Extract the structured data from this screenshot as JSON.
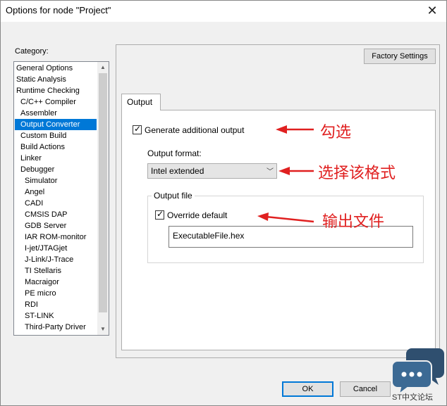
{
  "window": {
    "title": "Options for node \"Project\"",
    "close_glyph": "✕"
  },
  "category": {
    "label": "Category:",
    "items": [
      {
        "label": "General Options",
        "level": 0
      },
      {
        "label": "Static Analysis",
        "level": 0
      },
      {
        "label": "Runtime Checking",
        "level": 0
      },
      {
        "label": "C/C++ Compiler",
        "level": 1
      },
      {
        "label": "Assembler",
        "level": 1
      },
      {
        "label": "Output Converter",
        "level": 1,
        "selected": true
      },
      {
        "label": "Custom Build",
        "level": 1
      },
      {
        "label": "Build Actions",
        "level": 1
      },
      {
        "label": "Linker",
        "level": 1
      },
      {
        "label": "Debugger",
        "level": 1
      },
      {
        "label": "Simulator",
        "level": 2
      },
      {
        "label": "Angel",
        "level": 2
      },
      {
        "label": "CADI",
        "level": 2
      },
      {
        "label": "CMSIS DAP",
        "level": 2
      },
      {
        "label": "GDB Server",
        "level": 2
      },
      {
        "label": "IAR ROM-monitor",
        "level": 2
      },
      {
        "label": "I-jet/JTAGjet",
        "level": 2
      },
      {
        "label": "J-Link/J-Trace",
        "level": 2
      },
      {
        "label": "TI Stellaris",
        "level": 2
      },
      {
        "label": "Macraigor",
        "level": 2
      },
      {
        "label": "PE micro",
        "level": 2
      },
      {
        "label": "RDI",
        "level": 2
      },
      {
        "label": "ST-LINK",
        "level": 2
      },
      {
        "label": "Third-Party Driver",
        "level": 2
      }
    ]
  },
  "factory_settings_label": "Factory Settings",
  "tab": {
    "label": "Output"
  },
  "generate_output": {
    "label": "Generate additional output",
    "checked": true
  },
  "output_format": {
    "label": "Output format:",
    "value": "Intel extended"
  },
  "output_file": {
    "group_label": "Output file",
    "override_label": "Override default",
    "override_checked": true,
    "filename": "ExecutableFile.hex"
  },
  "annotations": {
    "check": "勾选",
    "select_format": "选择该格式",
    "output_file": "输出文件"
  },
  "footer": {
    "ok_label": "OK",
    "cancel_label": "Cancel"
  },
  "watermark": {
    "text": "ST中文论坛"
  },
  "colors": {
    "accent": "#0078d7",
    "annotation": "#e02020",
    "logo": "#2f4f6f"
  }
}
